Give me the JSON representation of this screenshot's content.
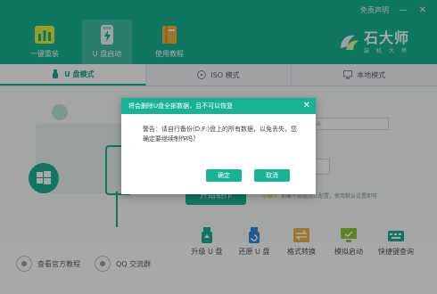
{
  "header": {
    "top_link": "免责声明",
    "window_controls": {
      "minimize": "—",
      "close": "✕"
    },
    "nav": [
      {
        "label": "一键重装",
        "icon": "bar-chart-icon"
      },
      {
        "label": "U 盘启动",
        "icon": "usb-lightning-icon"
      },
      {
        "label": "使用教程",
        "icon": "book-icon"
      }
    ],
    "brand": {
      "title": "石大师",
      "subtitle": "装 机 大 师"
    }
  },
  "tabs": [
    {
      "label": "U 盘模式",
      "icon": "usb-icon"
    },
    {
      "label": "ISO 模式",
      "icon": "disc-icon"
    },
    {
      "label": "本地模式",
      "icon": "monitor-icon"
    }
  ],
  "main": {
    "select_hint": "GB",
    "start_button": "开始制作",
    "hint_label": "小贴士",
    "hint_text": "如果不知道怎么配置，使用默认设置即可"
  },
  "tools": [
    {
      "label": "升级 U 盘",
      "icon": "usb-upgrade-icon"
    },
    {
      "label": "还原 U 盘",
      "icon": "usb-restore-icon"
    },
    {
      "label": "格式转换",
      "icon": "convert-icon"
    },
    {
      "label": "模拟启动",
      "icon": "simulate-boot-icon"
    },
    {
      "label": "快捷键查询",
      "icon": "keyboard-icon"
    }
  ],
  "footer": {
    "tutorial": "查看官方教程",
    "qq": "QQ 交流群"
  },
  "dialog": {
    "title": "将会删除U盘全部数据，且不可以恢复",
    "message": "警告：请自行备份(D:F:)盘上的所有数据，以免丢失，您确定要继续制作吗？",
    "confirm": "确定",
    "cancel": "取消",
    "close_icon": "✕"
  },
  "colors": {
    "brand": "#18b394",
    "hint_accent": "#e7a23a"
  }
}
